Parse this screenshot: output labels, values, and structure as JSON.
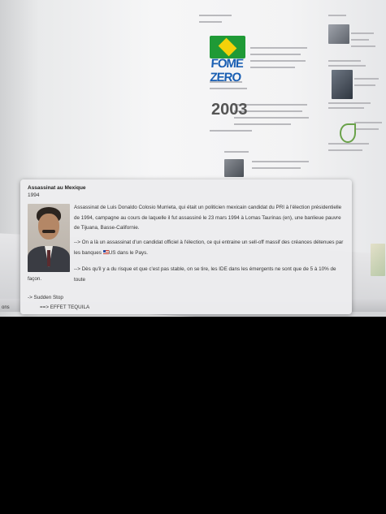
{
  "background": {
    "logo_text": "FOME ZERO",
    "year_text": "2003",
    "footer_fragment": "ons"
  },
  "card": {
    "title": "Assassinat au Mexique",
    "year": "1994",
    "paragraph1": "Assassinat de Luis Donaldo Colosio Murrieta, qui était un politicien mexicain candidat du PRI à l'élection présidentielle de 1994, campagne au cours de laquelle il fut assassiné le 23 mars 1994 à Lomas Taurinas (en), une banlieue pauvre de Tijuana, Basse-Californie.",
    "paragraph2_before_flag": "--> On a là un assassinat d'un candidat officiel à l'élection, ce qui entraine un sell-off massif des créances détenues par les banques ",
    "paragraph2_after_flag": "US dans le Pays.",
    "paragraph3": "--> Dès qu'il y a du risque et que c'est pas stable, on se tire, les IDE dans les émergents ne sont que de 5 à 10% de toute",
    "paragraph3_end": "façon.",
    "sudden_stop": "-> Sudden Stop",
    "effet_tequila": "==> EFFET TEQUILA"
  }
}
